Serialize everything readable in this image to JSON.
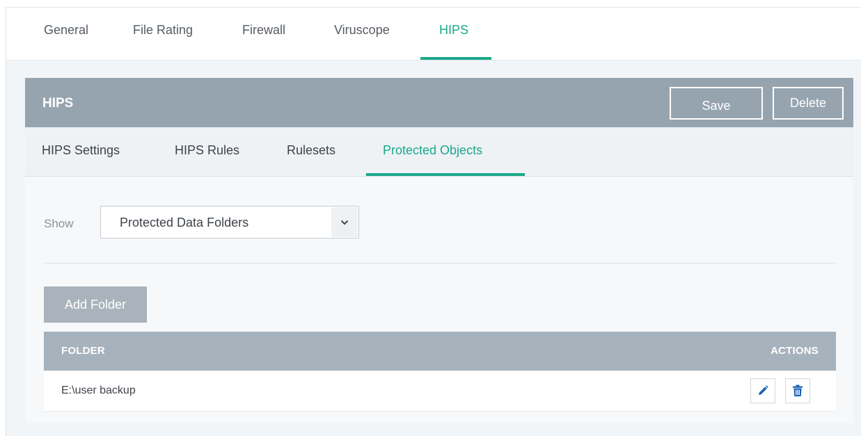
{
  "top_tabs": [
    {
      "label": "General",
      "active": false
    },
    {
      "label": "File Rating",
      "active": false
    },
    {
      "label": "Firewall",
      "active": false
    },
    {
      "label": "Viruscope",
      "active": false
    },
    {
      "label": "HIPS",
      "active": true
    }
  ],
  "panel": {
    "title": "HIPS",
    "save_label": "Save",
    "delete_label": "Delete"
  },
  "sub_tabs": [
    {
      "label": "HIPS Settings",
      "active": false
    },
    {
      "label": "HIPS Rules",
      "active": false
    },
    {
      "label": "Rulesets",
      "active": false
    },
    {
      "label": "Protected Objects",
      "active": true
    }
  ],
  "filter": {
    "label": "Show",
    "selected": "Protected Data Folders"
  },
  "add_folder_label": "Add Folder",
  "table": {
    "headers": {
      "folder": "FOLDER",
      "actions": "ACTIONS"
    },
    "rows": [
      {
        "folder": "E:\\user backup"
      }
    ]
  },
  "colors": {
    "accent": "#1aa88a",
    "header_bg": "#96a4b0",
    "table_header_bg": "#a6b2bc",
    "icon_blue": "#1a5fb4"
  },
  "icons": {
    "select_arrow": "chevron-down-icon",
    "edit": "pencil-icon",
    "delete": "trash-icon"
  }
}
